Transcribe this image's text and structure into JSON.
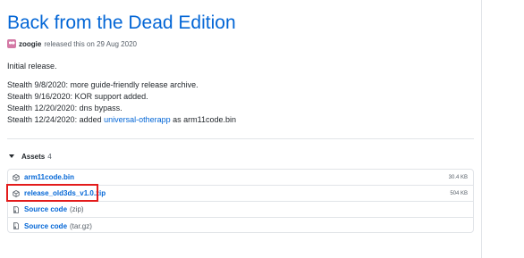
{
  "release": {
    "title": "Back from the Dead Edition",
    "author": "zoogie",
    "meta": "released this on 29 Aug 2020",
    "notes": {
      "intro": "Initial release.",
      "line1": "Stealth 9/8/2020: more guide-friendly release archive.",
      "line2": "Stealth 9/16/2020: KOR support added.",
      "line3": "Stealth 12/20/2020: dns bypass.",
      "line4_before": "Stealth 12/24/2020: added ",
      "line4_link": "universal-otherapp",
      "line4_after": " as arm11code.bin"
    }
  },
  "assets": {
    "label": "Assets",
    "count": "4",
    "items": [
      {
        "name": "arm11code.bin",
        "ext": "",
        "size": "30.4 KB",
        "icon": "package-icon"
      },
      {
        "name": "release_old3ds_v1.0.zip",
        "ext": "",
        "size": "504 KB",
        "icon": "package-icon"
      },
      {
        "name": "Source code",
        "ext": "(zip)",
        "size": "",
        "icon": "file-zip-icon"
      },
      {
        "name": "Source code",
        "ext": "(tar.gz)",
        "size": "",
        "icon": "file-zip-icon"
      }
    ]
  },
  "colors": {
    "link": "#0366d6",
    "highlight": "#e31b1b"
  }
}
